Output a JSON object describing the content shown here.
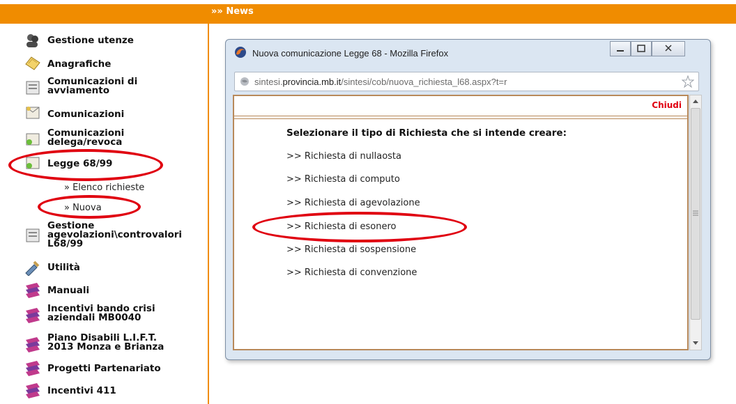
{
  "header": {
    "news_label": "»» News"
  },
  "sidebar": {
    "items": [
      {
        "label": "Gestione utenze",
        "icon": "users-icon"
      },
      {
        "label": "Anagrafiche",
        "icon": "address-book-icon"
      },
      {
        "label": "Comunicazioni di\navviamento",
        "icon": "document-icon"
      },
      {
        "label": "Comunicazioni",
        "icon": "document-icon"
      },
      {
        "label": "Comunicazioni\ndelega/revoca",
        "icon": "document-icon"
      },
      {
        "label": "Legge 68/99",
        "icon": "document-icon"
      },
      {
        "label": "Gestione\nagevolazioni\\controvalori\nL68/99",
        "icon": "document-icon"
      },
      {
        "label": "Utilità",
        "icon": "tools-icon"
      },
      {
        "label": "Manuali",
        "icon": "books-icon"
      },
      {
        "label": "Incentivi bando crisi\naziendali MB0040",
        "icon": "books-icon"
      },
      {
        "label": "Piano Disabili L.I.F.T.\n2013 Monza e Brianza",
        "icon": "books-icon"
      },
      {
        "label": "Progetti Partenariato",
        "icon": "books-icon"
      },
      {
        "label": "Incentivi 411",
        "icon": "books-icon"
      }
    ],
    "subitems": [
      {
        "label": "» Elenco richieste"
      },
      {
        "label": "» Nuova"
      }
    ]
  },
  "popup": {
    "title": "Nuova comunicazione Legge 68 - Mozilla Firefox",
    "url_prefix": "sintesi.",
    "url_domain": "provincia.mb.it",
    "url_path": "/sintesi/cob/nuova_richiesta_l68.aspx?t=r",
    "close_link": "Chiudi",
    "heading": "Selezionare il tipo di Richiesta che si intende creare:",
    "options": [
      ">> Richiesta di nullaosta",
      ">> Richiesta di computo",
      ">> Richiesta di agevolazione",
      ">> Richiesta di esonero",
      ">> Richiesta di sospensione",
      ">> Richiesta di convenzione"
    ]
  },
  "colors": {
    "accent": "#f08c00",
    "highlight": "#e00010"
  }
}
